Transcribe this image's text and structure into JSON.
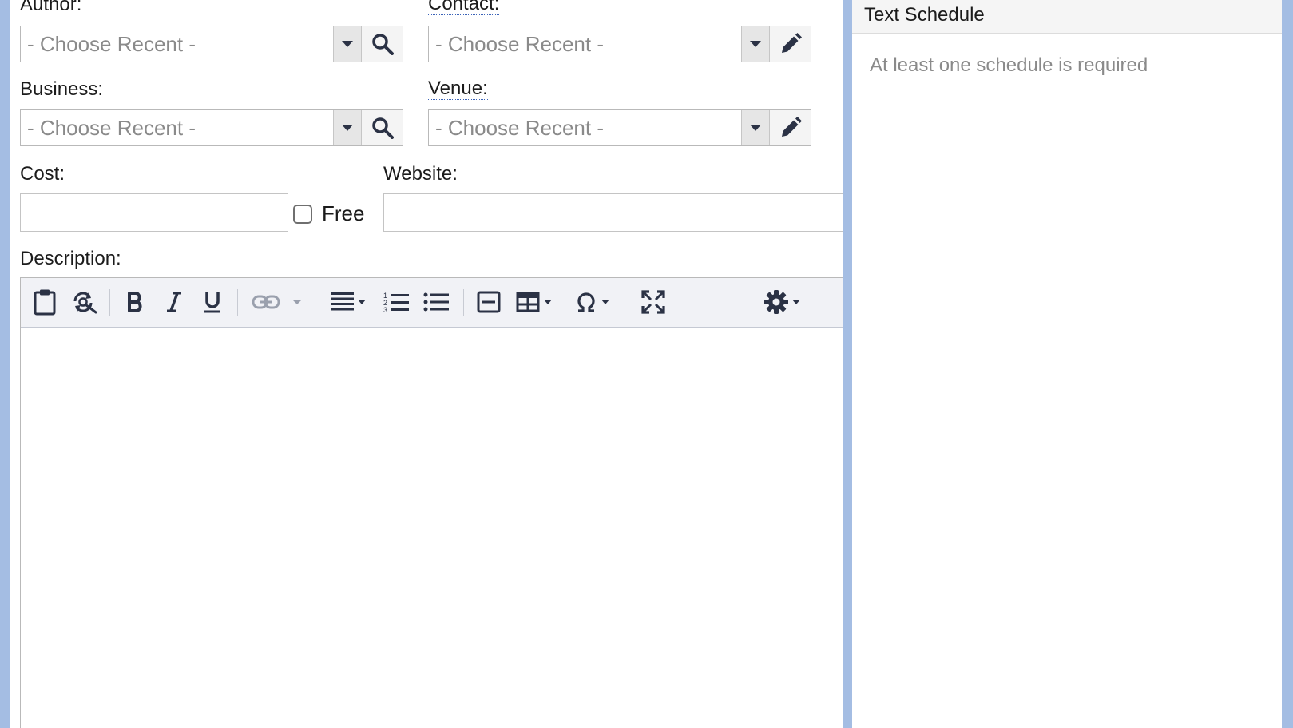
{
  "form": {
    "author": {
      "label": "Author:",
      "value": "- Choose Recent -"
    },
    "contact": {
      "label": "Contact:",
      "value": "- Choose Recent -"
    },
    "business": {
      "label": "Business:",
      "value": "- Choose Recent -"
    },
    "venue": {
      "label": "Venue:",
      "value": "- Choose Recent -"
    },
    "cost": {
      "label": "Cost:",
      "value": ""
    },
    "free": {
      "label": "Free",
      "checked": false
    },
    "website": {
      "label": "Website:",
      "value": ""
    },
    "description": {
      "label": "Description:"
    }
  },
  "toolbar": {
    "buttons": [
      "paste-icon",
      "find-replace-icon",
      "bold-icon",
      "italic-icon",
      "underline-icon",
      "link-icon",
      "align-icon",
      "ordered-list-icon",
      "bullet-list-icon",
      "horizontal-rule-icon",
      "table-icon",
      "special-character-icon",
      "fullscreen-icon",
      "gear-icon"
    ]
  },
  "schedule_panel": {
    "title": "Text Schedule",
    "message": "At least one schedule is required"
  },
  "colors": {
    "page_background": "#a4bde3",
    "toolbar_background": "#f1f2f6",
    "placeholder_text": "#8a8a8a",
    "icon": "#2b3245"
  }
}
